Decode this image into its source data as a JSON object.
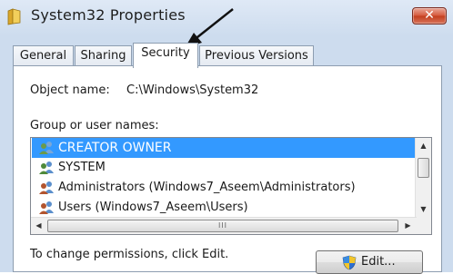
{
  "window": {
    "title": "System32 Properties",
    "close_label": "✕"
  },
  "tabs": [
    {
      "label": "General",
      "active": false
    },
    {
      "label": "Sharing",
      "active": false
    },
    {
      "label": "Security",
      "active": true
    },
    {
      "label": "Previous Versions",
      "active": false
    }
  ],
  "security": {
    "object_name_label": "Object name:",
    "object_name_value": "C:\\Windows\\System32",
    "group_label": "Group or user names:",
    "users": [
      {
        "name": "CREATOR OWNER",
        "icon": "users-group-icon",
        "selected": true
      },
      {
        "name": "SYSTEM",
        "icon": "users-group-icon",
        "selected": false
      },
      {
        "name": "Administrators (Windows7_Aseem\\Administrators)",
        "icon": "users-group-icon",
        "selected": false
      },
      {
        "name": "Users (Windows7_Aseem\\Users)",
        "icon": "users-group-icon",
        "selected": false
      }
    ],
    "scroll_grip": "III",
    "change_text": "To change permissions, click Edit.",
    "edit_label": "Edit..."
  },
  "colors": {
    "selection": "#3399ff",
    "close_button": "#c23d1d",
    "frame": "#cddcee"
  }
}
